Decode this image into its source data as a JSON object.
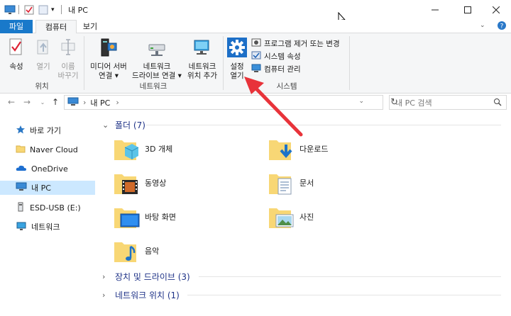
{
  "window": {
    "title": "내 PC",
    "quick_access_dropdown": "▾"
  },
  "ribbon_tabs": {
    "file": "파일",
    "computer": "컴퓨터",
    "view": "보기"
  },
  "ribbon": {
    "location_group": {
      "label": "위치",
      "properties": "속성",
      "open": "열기",
      "rename_line1": "이름",
      "rename_line2": "바꾸기"
    },
    "network_group": {
      "label": "네트워크",
      "media_server_line1": "미디어 서버",
      "media_server_line2": "연결 ▾",
      "map_drive_line1": "네트워크",
      "map_drive_line2": "드라이브 연결 ▾",
      "add_location_line1": "네트워크",
      "add_location_line2": "위치 추가"
    },
    "system_group": {
      "label": "시스템",
      "settings_line1": "설정",
      "settings_line2": "열기",
      "uninstall": "프로그램 제거 또는 변경",
      "system_properties": "시스템 속성",
      "manage": "컴퓨터 관리"
    }
  },
  "addressbar": {
    "path": [
      "내 PC"
    ],
    "search_placeholder": "내 PC 검색"
  },
  "navpane": {
    "items": [
      {
        "label": "바로 가기",
        "icon": "star-icon"
      },
      {
        "label": "Naver Cloud",
        "icon": "cloud-folder-icon"
      },
      {
        "label": "OneDrive",
        "icon": "onedrive-icon"
      },
      {
        "label": "내 PC",
        "icon": "pc-icon",
        "selected": true
      },
      {
        "label": "ESD-USB (E:)",
        "icon": "usb-drive-icon"
      },
      {
        "label": "네트워크",
        "icon": "network-icon"
      }
    ]
  },
  "content": {
    "folders_header": "폴더 (7)",
    "devices_header": "장치 및 드라이브 (3)",
    "network_header": "네트워크 위치 (1)",
    "folders": [
      {
        "label": "3D 개체",
        "icon": "3d-objects-folder-icon"
      },
      {
        "label": "다운로드",
        "icon": "downloads-folder-icon"
      },
      {
        "label": "동영상",
        "icon": "videos-folder-icon"
      },
      {
        "label": "문서",
        "icon": "documents-folder-icon"
      },
      {
        "label": "바탕 화면",
        "icon": "desktop-folder-icon"
      },
      {
        "label": "사진",
        "icon": "pictures-folder-icon"
      },
      {
        "label": "음악",
        "icon": "music-folder-icon"
      }
    ]
  },
  "colors": {
    "accent": "#1979ca",
    "selection": "#cce8ff",
    "section_text": "#1e3287",
    "annotation_arrow": "#e8333a",
    "folder_yellow": "#f8d775"
  }
}
